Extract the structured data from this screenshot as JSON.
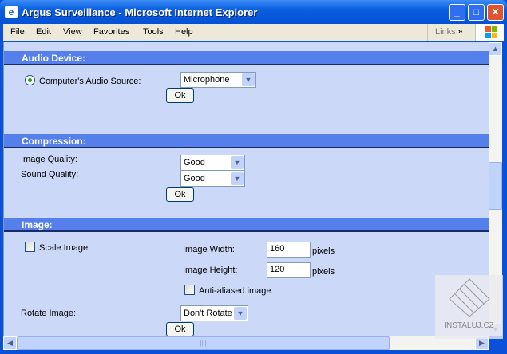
{
  "window": {
    "title": "Argus Surveillance - Microsoft Internet Explorer",
    "minimize": "_",
    "maximize": "□",
    "close": "✕"
  },
  "menu": [
    "File",
    "Edit",
    "View",
    "Favorites",
    "Tools",
    "Help"
  ],
  "links": {
    "label": "Links",
    "chevron": "»"
  },
  "audio": {
    "heading": "Audio Device:",
    "source_label": "Computer's Audio Source:",
    "source_value": "Microphone",
    "ok": "Ok"
  },
  "compression": {
    "heading": "Compression:",
    "image_quality_label": "Image Quality:",
    "image_quality_value": "Good",
    "sound_quality_label": "Sound Quality:",
    "sound_quality_value": "Good",
    "ok": "Ok"
  },
  "image": {
    "heading": "Image:",
    "scale_label": "Scale Image",
    "width_label": "Image Width:",
    "width_value": "160",
    "height_label": "Image Height:",
    "height_value": "120",
    "unit": "pixels",
    "antialias_label": "Anti-aliased image",
    "rotate_label": "Rotate Image:",
    "rotate_value": "Don't Rotate",
    "ok": "Ok"
  },
  "watermark": "INSTALUJ.CZ"
}
